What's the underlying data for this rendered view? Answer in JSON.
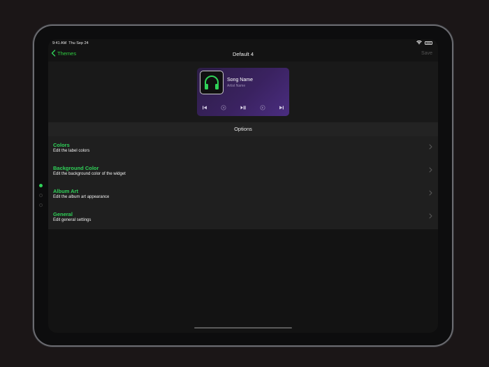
{
  "status_bar": {
    "time": "9:41 AM",
    "date": "Thu Sep 24"
  },
  "nav": {
    "back_label": "Themes",
    "title": "Default 4",
    "save_label": "Save"
  },
  "widget_preview": {
    "song_name": "Song Name",
    "artist_name": "Artist Name"
  },
  "options": {
    "header": "Options",
    "items": [
      {
        "title": "Colors",
        "subtitle": "Edit the label colors"
      },
      {
        "title": "Background Color",
        "subtitle": "Edit the background color of the widget"
      },
      {
        "title": "Album Art",
        "subtitle": "Edit the album art appearance"
      },
      {
        "title": "General",
        "subtitle": "Edit general settings"
      }
    ]
  },
  "colors": {
    "accent": "#2fd158",
    "background": "#131313",
    "widget_gradient_start": "#2d1e47",
    "widget_gradient_end": "#4a2d80"
  },
  "icons": [
    "wifi-icon",
    "battery-icon",
    "chevron-left-icon",
    "headphones-icon",
    "skip-back-icon",
    "rewind-icon",
    "play-pause-icon",
    "forward-icon",
    "skip-forward-icon",
    "chevron-right-icon"
  ]
}
